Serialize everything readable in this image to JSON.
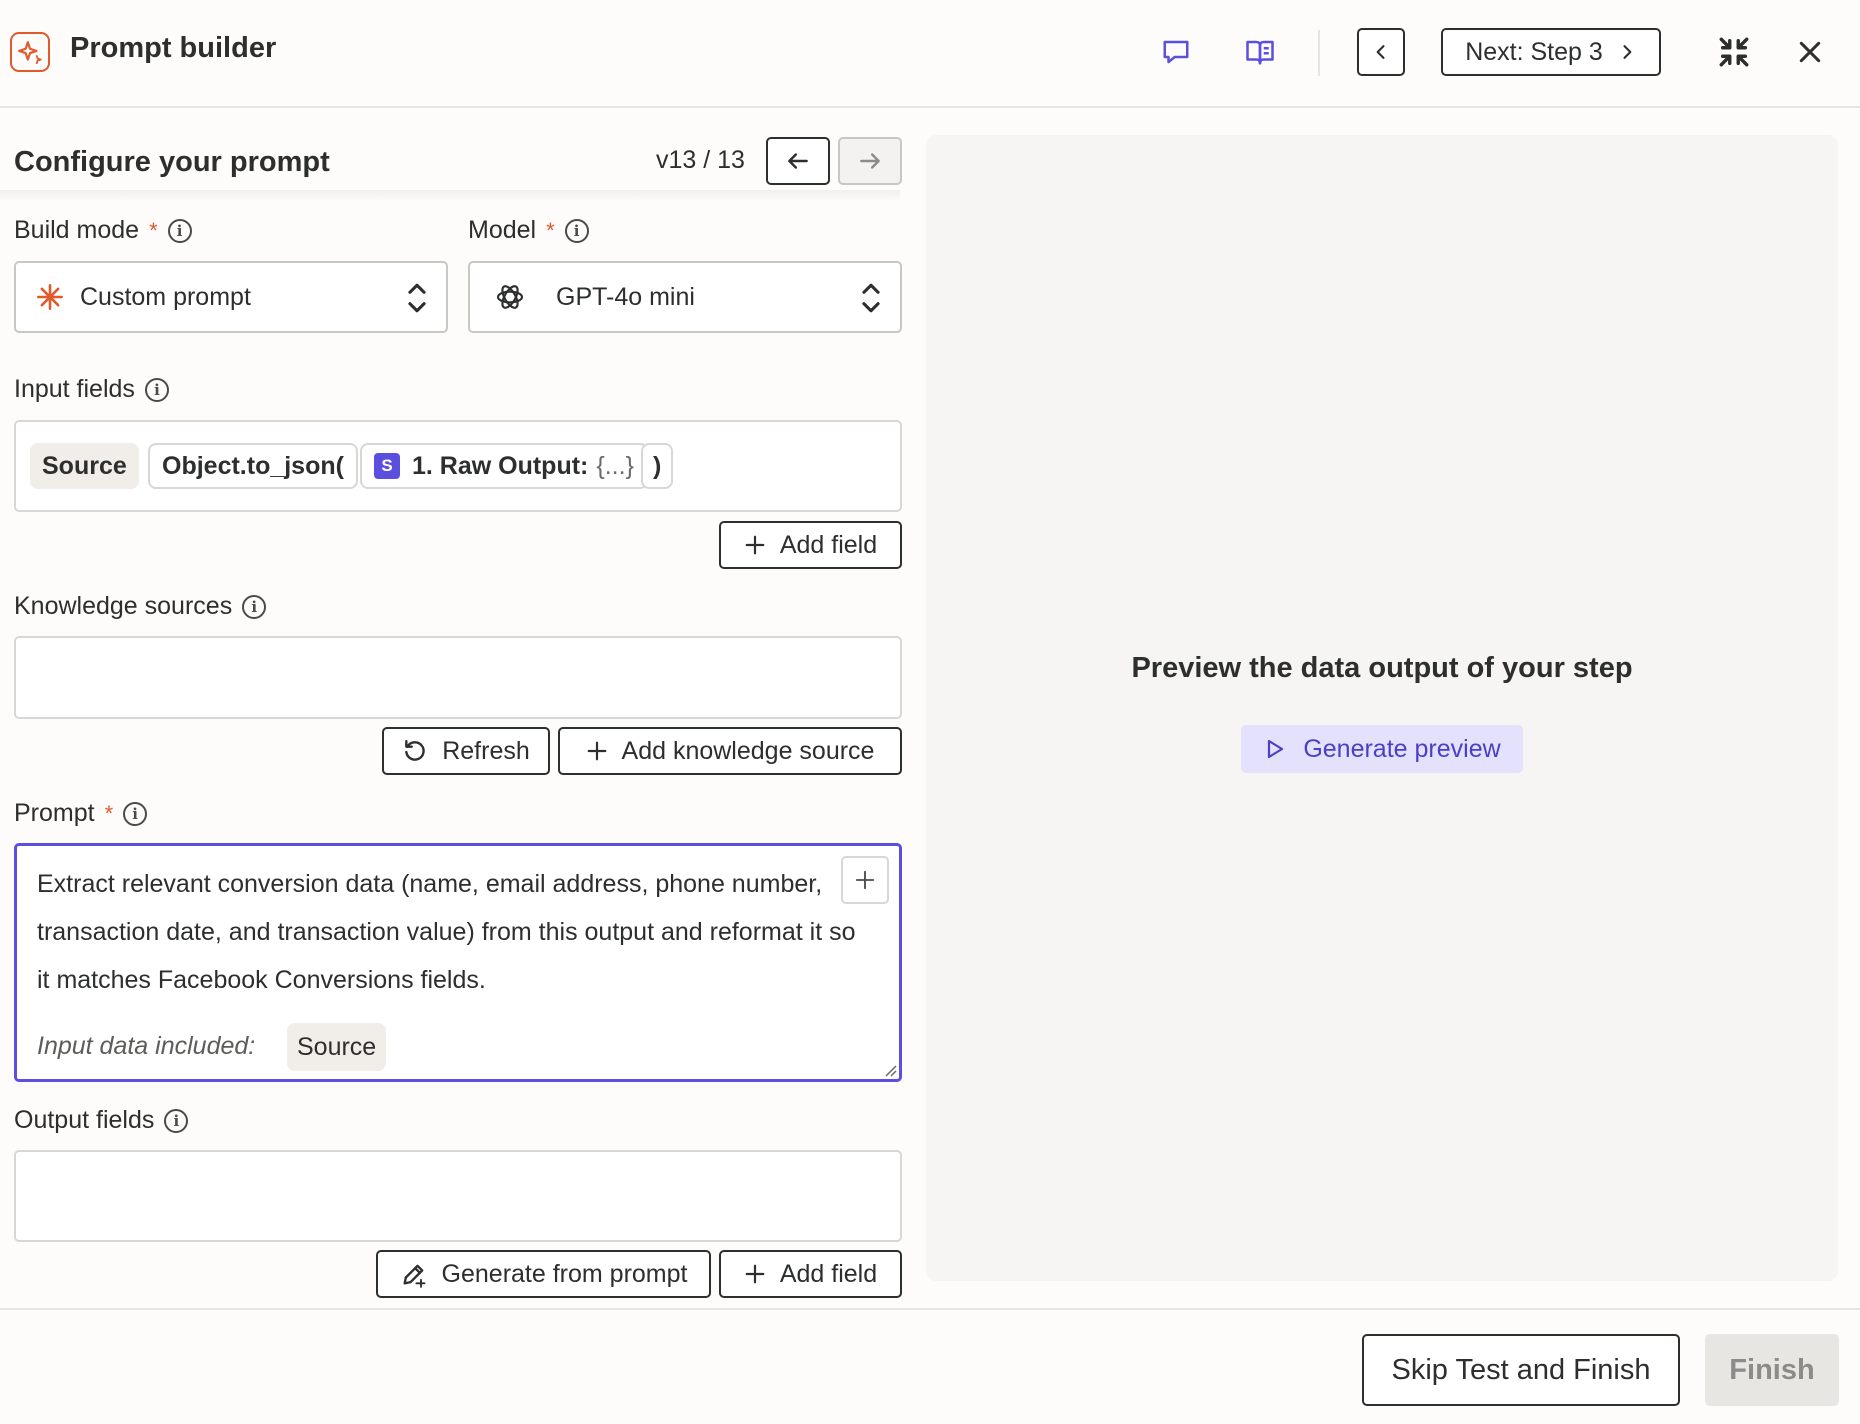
{
  "header": {
    "title": "Prompt builder",
    "next_step_label": "Next: Step 3",
    "icons": [
      "logo-icon",
      "comment-icon",
      "book-icon",
      "chevron-left-icon",
      "chevron-right-icon",
      "collapse-icon",
      "close-icon"
    ]
  },
  "configure": {
    "title": "Configure your prompt",
    "version": "v13 / 13"
  },
  "build_mode": {
    "label": "Build mode",
    "required_mark": "*",
    "value": "Custom prompt"
  },
  "model": {
    "label": "Model",
    "required_mark": "*",
    "value": "GPT-4o mini"
  },
  "input_fields": {
    "label": "Input fields",
    "source_pill": "Source",
    "func_pill": "Object.to_json(",
    "step_badge": "S",
    "raw_output_label": "1. Raw Output:",
    "raw_output_value": "{...}",
    "close_paren": ")",
    "add_field_label": "Add field"
  },
  "knowledge": {
    "label": "Knowledge sources",
    "refresh_label": "Refresh",
    "add_source_label": "Add knowledge source"
  },
  "prompt": {
    "label": "Prompt",
    "required_mark": "*",
    "text": "Extract relevant conversion data (name, email address, phone number, transaction date, and transaction value) from this output and reformat it so it matches Facebook Conversions fields.",
    "included_label": "Input data included:",
    "included_pill": "Source"
  },
  "output_fields": {
    "label": "Output fields",
    "generate_label": "Generate from prompt",
    "add_field_label": "Add field"
  },
  "preview": {
    "title": "Preview the data output of your step",
    "button_label": "Generate preview"
  },
  "footer": {
    "skip_label": "Skip Test and Finish",
    "finish_label": "Finish"
  },
  "colors": {
    "accent": "#5b4fe0",
    "brand_orange": "#e05a2b",
    "preview_button_bg": "#e3e1fb"
  }
}
